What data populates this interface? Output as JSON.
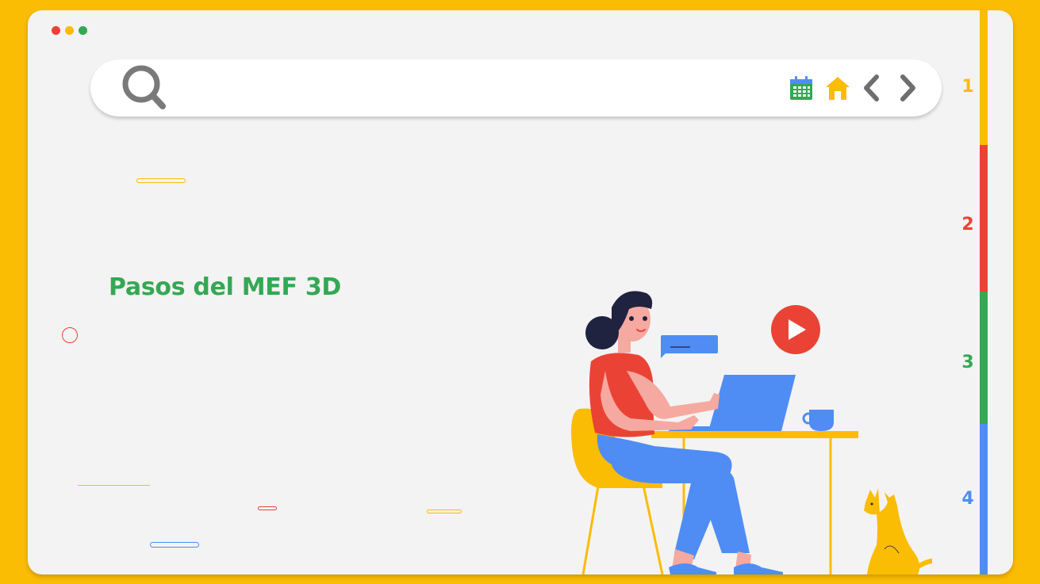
{
  "window": {
    "controls": [
      {
        "name": "close",
        "color": "#EA4335"
      },
      {
        "name": "minimize",
        "color": "#FBBC04"
      },
      {
        "name": "maximize",
        "color": "#34A853"
      }
    ]
  },
  "search": {
    "icon": "search-icon",
    "placeholder": "",
    "value": ""
  },
  "toolbar": {
    "icons": [
      "calendar-icon",
      "home-icon",
      "chevron-left-icon",
      "chevron-right-icon"
    ]
  },
  "tabs": [
    {
      "label": "1",
      "color": "#FBBC04"
    },
    {
      "label": "2",
      "color": "#EA4335"
    },
    {
      "label": "3",
      "color": "#34A853"
    },
    {
      "label": "4",
      "color": "#4F8DF5"
    }
  ],
  "content": {
    "title": "Pasos del MEF 3D",
    "title_color": "#34A853"
  },
  "colors": {
    "background": "#FBBC04",
    "panel": "#F3F3F3",
    "accent_blue": "#4F8DF5",
    "accent_red": "#EA4335",
    "accent_green": "#34A853",
    "accent_yellow": "#FBBC04"
  },
  "illustration": {
    "subject": "woman-working-on-laptop",
    "elements": [
      "play-button-icon",
      "chat-bubble-icon",
      "laptop",
      "coffee-cup",
      "cat",
      "chair",
      "desk"
    ]
  }
}
